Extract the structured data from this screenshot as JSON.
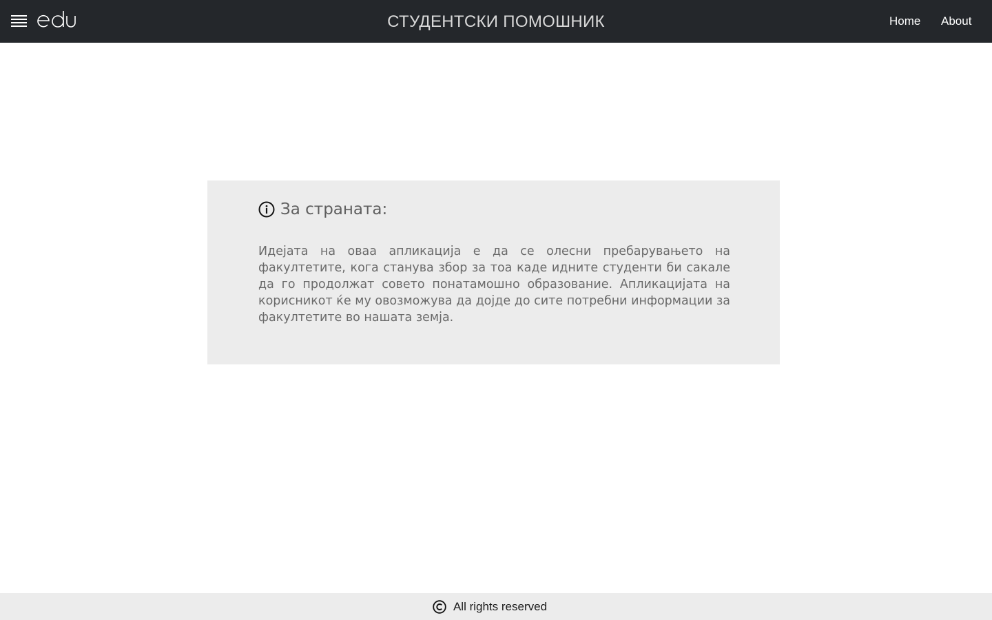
{
  "header": {
    "menu_icon": "hamburger-icon",
    "logo_text": "edu",
    "title": "СТУДЕНТСКИ ПОМОШНИК",
    "nav": [
      {
        "label": "Home"
      },
      {
        "label": "About"
      }
    ],
    "background_color": "#24272b"
  },
  "about_card": {
    "icon": "info-icon",
    "title": "За страната:",
    "body": "Идејата на оваа апликација е да се олесни пребарувањето на факултетите, кога станува збор за тоа каде идните студенти би сакале да го продолжат совето понатамошно образование. Апликацијата на корисникот ќе му овозможува да дојде до сите потребни информации за факултетите во нашата земја.",
    "background_color": "#ececec"
  },
  "footer": {
    "icon": "copyright-icon",
    "text": "All rights reserved"
  }
}
